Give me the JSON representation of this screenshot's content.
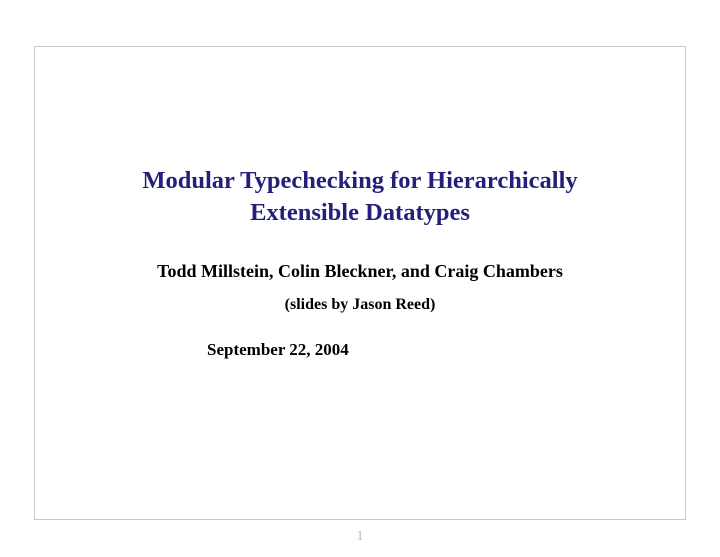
{
  "title_line1": "Modular Typechecking for Hierarchically",
  "title_line2": "Extensible Datatypes",
  "authors": "Todd Millstein, Colin Bleckner, and Craig Chambers",
  "slides_by": "(slides by Jason Reed)",
  "date": "September 22, 2004",
  "page_number": "1"
}
